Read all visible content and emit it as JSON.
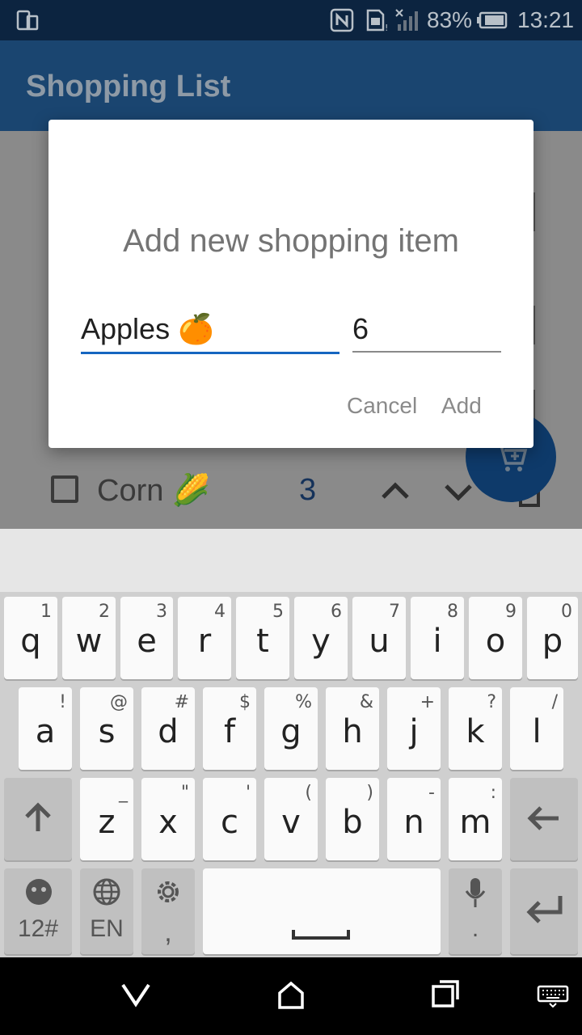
{
  "status_bar": {
    "battery": "83%",
    "time": "13:21",
    "icons": [
      "phone-mode-icon",
      "nfc-icon",
      "sim-alert-icon",
      "no-signal-icon",
      "battery-icon"
    ]
  },
  "app": {
    "title": "Shopping List",
    "primary_color": "#1a4570"
  },
  "list": {
    "visible_item": {
      "name": "Corn 🌽",
      "quantity": "3",
      "checked": false
    },
    "icons": [
      "increase-chevron-icon",
      "decrease-chevron-icon",
      "delete-icon",
      "add-to-cart-icon"
    ]
  },
  "dialog": {
    "title": "Add new shopping item",
    "item_name_value": "Apples 🍊",
    "quantity_value": "6",
    "cancel_label": "Cancel",
    "add_label": "Add",
    "accent_color": "#1565c0"
  },
  "keyboard": {
    "row1": [
      {
        "key": "q",
        "alt": "1"
      },
      {
        "key": "w",
        "alt": "2"
      },
      {
        "key": "e",
        "alt": "3"
      },
      {
        "key": "r",
        "alt": "4"
      },
      {
        "key": "t",
        "alt": "5"
      },
      {
        "key": "y",
        "alt": "6"
      },
      {
        "key": "u",
        "alt": "7"
      },
      {
        "key": "i",
        "alt": "8"
      },
      {
        "key": "o",
        "alt": "9"
      },
      {
        "key": "p",
        "alt": "0"
      }
    ],
    "row2": [
      {
        "key": "a",
        "alt": "!"
      },
      {
        "key": "s",
        "alt": "@"
      },
      {
        "key": "d",
        "alt": "#"
      },
      {
        "key": "f",
        "alt": "$"
      },
      {
        "key": "g",
        "alt": "%"
      },
      {
        "key": "h",
        "alt": "&"
      },
      {
        "key": "j",
        "alt": "+"
      },
      {
        "key": "k",
        "alt": "?"
      },
      {
        "key": "l",
        "alt": "/"
      }
    ],
    "row3": [
      {
        "key": "z",
        "alt": "_"
      },
      {
        "key": "x",
        "alt": "\""
      },
      {
        "key": "c",
        "alt": "'"
      },
      {
        "key": "v",
        "alt": "("
      },
      {
        "key": "b",
        "alt": ")"
      },
      {
        "key": "n",
        "alt": "-"
      },
      {
        "key": "m",
        "alt": ":"
      }
    ],
    "symbols_label": "12#",
    "language_label": "EN",
    "comma_label": ",",
    "mic_sub_label": "."
  },
  "nav_bar": {
    "icons": [
      "back-icon",
      "home-icon",
      "recents-icon",
      "keyboard-switch-icon"
    ]
  }
}
